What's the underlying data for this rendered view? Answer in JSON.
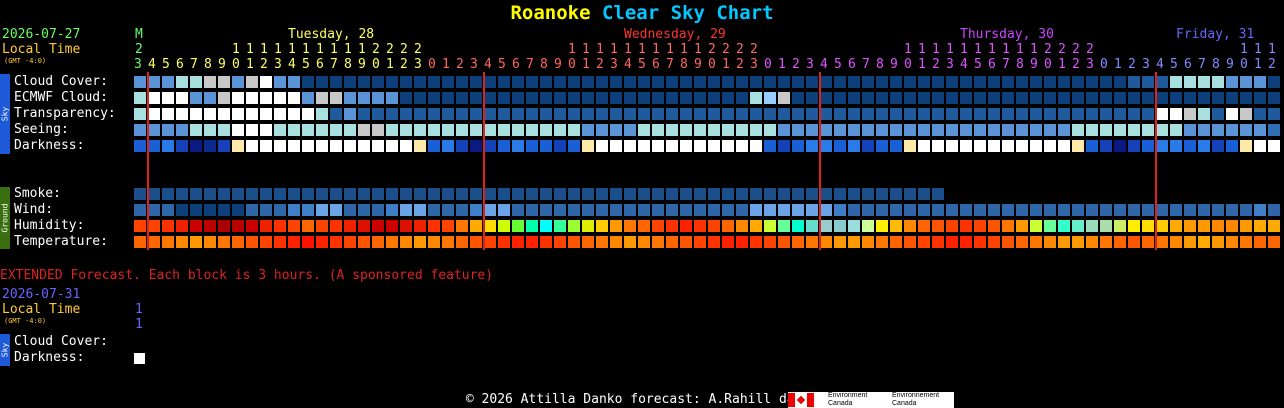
{
  "title": {
    "part1": "Roanoke",
    "part2": "Clear Sky Chart"
  },
  "header": {
    "date": "2026-07-27",
    "local_time": "Local Time",
    "gmt": "(GMT -4:0)",
    "m_label": "M",
    "m_num": "2"
  },
  "days": [
    {
      "label": "Tuesday, 28",
      "color": "#ffff66"
    },
    {
      "label": "Wednesday, 29",
      "color": "#ff3333"
    },
    {
      "label": "Thursday, 30",
      "color": "#cc44ff"
    },
    {
      "label": "Friday, 31",
      "color": "#6666ff"
    }
  ],
  "hour_digits_top": "              1111111111112222               1111111111112222               1111111111112222",
  "hour_digits_bottom": "301234567890123456789012301234567890123456789012301234567890123456789012301234567890123456789012301234567800",
  "rows_sky": [
    "Cloud Cover:",
    "ECMWF Cloud:",
    "Transparency:",
    "Seeing:",
    "Darkness:"
  ],
  "rows_ground": [
    "Smoke:",
    "Wind:",
    "Humidity:",
    "Temperature:"
  ],
  "sidebar": {
    "sky": "Sky",
    "ground": "Ground"
  },
  "extended": {
    "notice": "EXTENDED Forecast. Each block is 3 hours. (A sponsored feature)",
    "date": "2026-07-31",
    "local_time": "Local Time",
    "gmt": "(GMT -4:0)",
    "num1": "1",
    "num2": "1",
    "rows": [
      "Cloud Cover:",
      "Darkness:"
    ]
  },
  "footer": {
    "text": "© 2026 Attilla Danko  forecast: A.Rahill  data:",
    "logo_en": "Environment Canada",
    "logo_fr": "Environnement Canada"
  },
  "colors": {
    "clear": "#0d3f7a",
    "partly": "#2e66a8",
    "cloudy": "#99ccff",
    "overcast": "#ffffff",
    "red_line": "#dd2222"
  }
}
